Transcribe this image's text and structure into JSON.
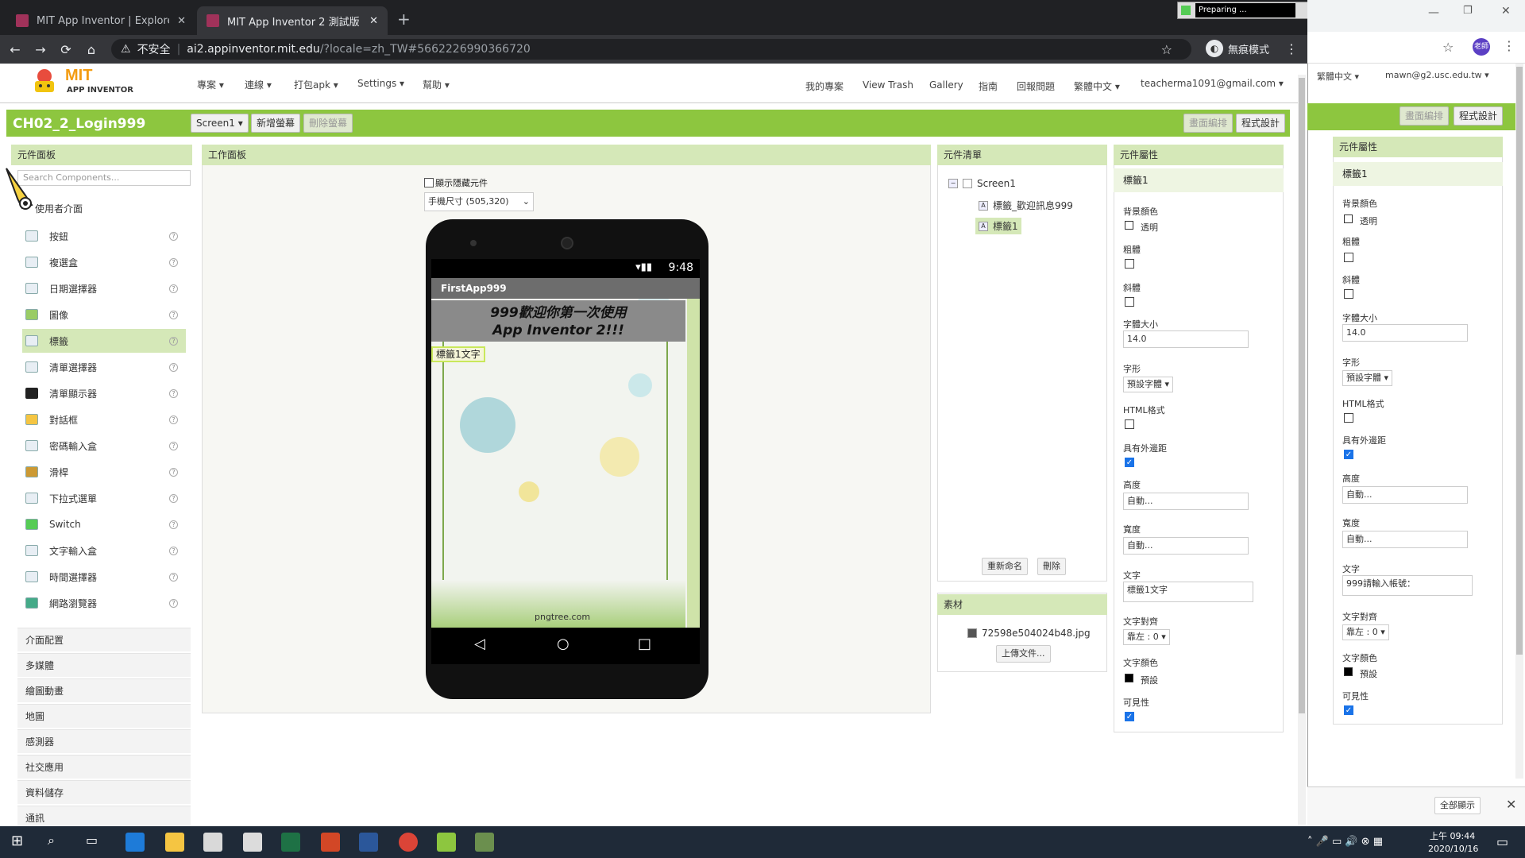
{
  "browser": {
    "tabs": [
      {
        "label": "MIT App Inventor | Explore MIT"
      },
      {
        "label": "MIT App Inventor 2 測試版"
      }
    ],
    "insecure_label": "不安全",
    "url_host": "ai2.appinventor.mit.edu",
    "url_path": "/?locale=zh_TW#5662226990366720",
    "incognito_label": "無痕模式",
    "preparing_label": "Preparing ..."
  },
  "app": {
    "logo_title": "MIT",
    "logo_subtitle": "APP INVENTOR",
    "left_menu": [
      "專案 ▾",
      "連線 ▾",
      "打包apk ▾",
      "Settings ▾",
      "幫助 ▾"
    ],
    "right_menu": [
      "我的專案",
      "View Trash",
      "Gallery",
      "指南",
      "回報問題",
      "繁體中文 ▾",
      "teacherma1091@gmail.com ▾"
    ],
    "project_name": "CH02_2_Login999",
    "screen_select": "Screen1 ▾",
    "add_screen": "新增螢幕",
    "remove_screen": "刪除螢幕",
    "designer_btn": "畫面編排",
    "blocks_btn": "程式設計"
  },
  "palette": {
    "title": "元件面板",
    "search_placeholder": "Search Components...",
    "category_open": "使用者介面",
    "items": [
      "按鈕",
      "複選盒",
      "日期選擇器",
      "圖像",
      "標籤",
      "清單選擇器",
      "清單顯示器",
      "對話框",
      "密碼輸入盒",
      "滑桿",
      "下拉式選單",
      "Switch",
      "文字輸入盒",
      "時間選擇器",
      "網路瀏覽器"
    ],
    "selected_item": "標籤",
    "categories": [
      "介面配置",
      "多媒體",
      "繪圖動畫",
      "地圖",
      "感測器",
      "社交應用",
      "資料儲存",
      "通訊"
    ]
  },
  "viewer": {
    "title": "工作面板",
    "hidden_checkbox_label": "顯示隱藏元件",
    "size_select": "手機尺寸 (505,320)",
    "status_time": "9:48",
    "app_title": "FirstApp999",
    "welcome_line1": "999歡迎你第一次使用",
    "welcome_line2": "App Inventor 2!!!",
    "label1_text": "標籤1文字",
    "watermark": "pngtree.com"
  },
  "tree": {
    "title": "元件清單",
    "root": "Screen1",
    "children": [
      "標籤_歡迎訊息999",
      "標籤1"
    ],
    "rename_btn": "重新命名",
    "delete_btn": "刪除"
  },
  "media": {
    "title": "素材",
    "file": "72598e504024b48.jpg",
    "upload_btn": "上傳文件..."
  },
  "props": {
    "title": "元件屬性",
    "component": "標籤1",
    "bg_color_label": "背景顏色",
    "bg_color_value": "透明",
    "bold_label": "粗體",
    "italic_label": "斜體",
    "font_size_label": "字體大小",
    "font_size_value": "14.0",
    "font_face_label": "字形",
    "font_face_value": "預設字體 ▾",
    "html_label": "HTML格式",
    "margin_label": "具有外邊距",
    "height_label": "高度",
    "height_value": "自動...",
    "width_label": "寬度",
    "width_value": "自動...",
    "text_label": "文字",
    "text_value": "標籤1文字",
    "align_label": "文字對齊",
    "align_value": "靠左 : 0 ▾",
    "text_color_label": "文字顏色",
    "text_color_value": "預設",
    "visible_label": "可見性"
  },
  "second_window": {
    "lang": "繁體中文 ▾",
    "account": "mawn@g2.usc.edu.tw ▾",
    "designer_btn": "畫面編排",
    "blocks_btn": "程式設計",
    "props_title": "元件屬性",
    "component": "標籤1",
    "bg_color_label": "背景顏色",
    "bg_color_value": "透明",
    "bold_label": "粗體",
    "italic_label": "斜體",
    "font_size_label": "字體大小",
    "font_size_value": "14.0",
    "font_face_label": "字形",
    "font_face_value": "預設字體 ▾",
    "html_label": "HTML格式",
    "margin_label": "具有外邊距",
    "height_label": "高度",
    "height_value": "自動...",
    "width_label": "寬度",
    "width_value": "自動...",
    "text_label": "文字",
    "text_value": "999請輸入帳號：",
    "align_label": "文字對齊",
    "align_value": "靠左 : 0 ▾",
    "text_color_label": "文字顏色",
    "text_color_value": "預設",
    "visible_label": "可見性",
    "show_all_btn": "全部顯示"
  },
  "taskbar": {
    "time": "上午 09:44",
    "date": "2020/10/16"
  },
  "colors": {
    "accent_green": "#8dc63f",
    "panel_head": "#d5e8b8",
    "chrome_dark": "#202124"
  }
}
